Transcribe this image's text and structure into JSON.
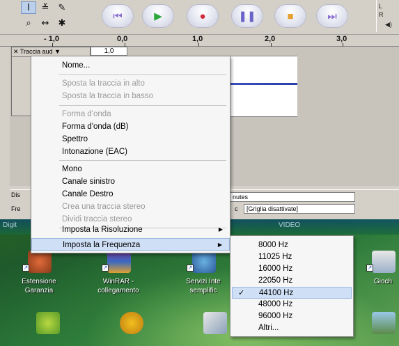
{
  "ruler": {
    "labels": [
      "- 1,0",
      "0,0",
      "1,0",
      "2,0",
      "3,0"
    ]
  },
  "track": {
    "title": "Traccia aud",
    "volume": "1,0"
  },
  "selection_bar": {
    "left_label": "Dis",
    "freq_label": "Fre",
    "minutes_text": "nutes",
    "snap_text": "[Griglia disattivate]"
  },
  "menu": {
    "items": [
      {
        "label": "Nome...",
        "enabled": true
      },
      {
        "label": "Sposta la traccia in alto",
        "enabled": false
      },
      {
        "label": "Sposta la traccia in basso",
        "enabled": false
      },
      {
        "label": "Forma d'onda",
        "enabled": false
      },
      {
        "label": "Forma d'onda (dB)",
        "enabled": true
      },
      {
        "label": "Spettro",
        "enabled": true
      },
      {
        "label": "Intonazione (EAC)",
        "enabled": true
      },
      {
        "label": "Mono",
        "enabled": true
      },
      {
        "label": "Canale sinistro",
        "enabled": true
      },
      {
        "label": "Canale Destro",
        "enabled": true
      },
      {
        "label": "Crea una traccia stereo",
        "enabled": false
      },
      {
        "label": "Dividi traccia stereo",
        "enabled": false
      },
      {
        "label": "Imposta la Risoluzione",
        "enabled": true
      },
      {
        "label": "Imposta la Frequenza",
        "enabled": true
      }
    ]
  },
  "submenu": {
    "items": [
      "8000 Hz",
      "11025 Hz",
      "16000 Hz",
      "22050 Hz",
      "44100 Hz",
      "48000 Hz",
      "96000 Hz",
      "Altri..."
    ],
    "checked": "44100 Hz"
  },
  "desktop": {
    "strip_left": "Digit",
    "strip_right": "VIDEO",
    "icons": [
      {
        "label_line1": "Estensione",
        "label_line2": "Garanzia"
      },
      {
        "label_line1": "WinRAR -",
        "label_line2": "collegamento"
      },
      {
        "label_line1": "Servizi Inte",
        "label_line2": "semplific"
      },
      {
        "label_line1": "Gioch",
        "label_line2": ""
      }
    ]
  },
  "colors": {
    "highlight": "#cfe0f6",
    "waveform": "#2b3fa8"
  }
}
